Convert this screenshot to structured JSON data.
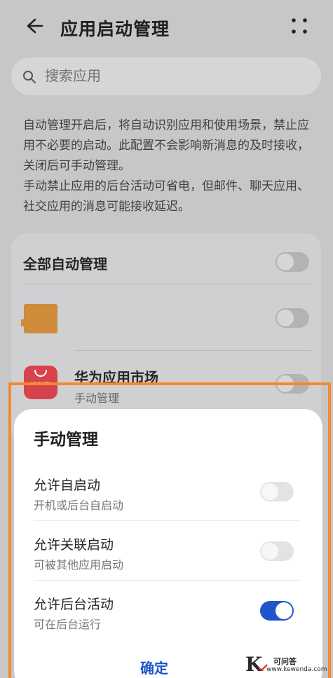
{
  "header": {
    "title": "应用启动管理",
    "back_icon": "arrow-left-icon",
    "more_icon": "more-dots-icon"
  },
  "search": {
    "placeholder": "搜索应用",
    "icon": "search-icon"
  },
  "description": {
    "p1": "自动管理开启后，将自动识别应用和使用场景，禁止应用不必要的启动。此配置不会影响新消息的及时接收，关闭后可手动管理。",
    "p2": "手动禁止应用的后台活动可省电，但邮件、聊天应用、社交应用的消息可能接收延迟。"
  },
  "list": {
    "all_auto_label": "全部自动管理",
    "all_auto_on": false,
    "apps": [
      {
        "name": "",
        "subtitle": "",
        "on": false
      },
      {
        "name": "华为应用市场",
        "subtitle": "手动管理",
        "icon_text": "HUAWEI",
        "on": false
      }
    ]
  },
  "dialog": {
    "title": "手动管理",
    "items": [
      {
        "title": "允许自启动",
        "subtitle": "开机或后台自启动",
        "on": false
      },
      {
        "title": "允许关联启动",
        "subtitle": "可被其他应用启动",
        "on": false
      },
      {
        "title": "允许后台活动",
        "subtitle": "可在后台运行",
        "on": true
      }
    ],
    "confirm_label": "确定"
  },
  "watermark": {
    "letter": "K",
    "cn": "可问答",
    "url": "www.kewenda.com"
  },
  "colors": {
    "accent": "#1f56c9",
    "highlight": "#f28a2e",
    "overlay_bg": "#c7c7c9"
  }
}
